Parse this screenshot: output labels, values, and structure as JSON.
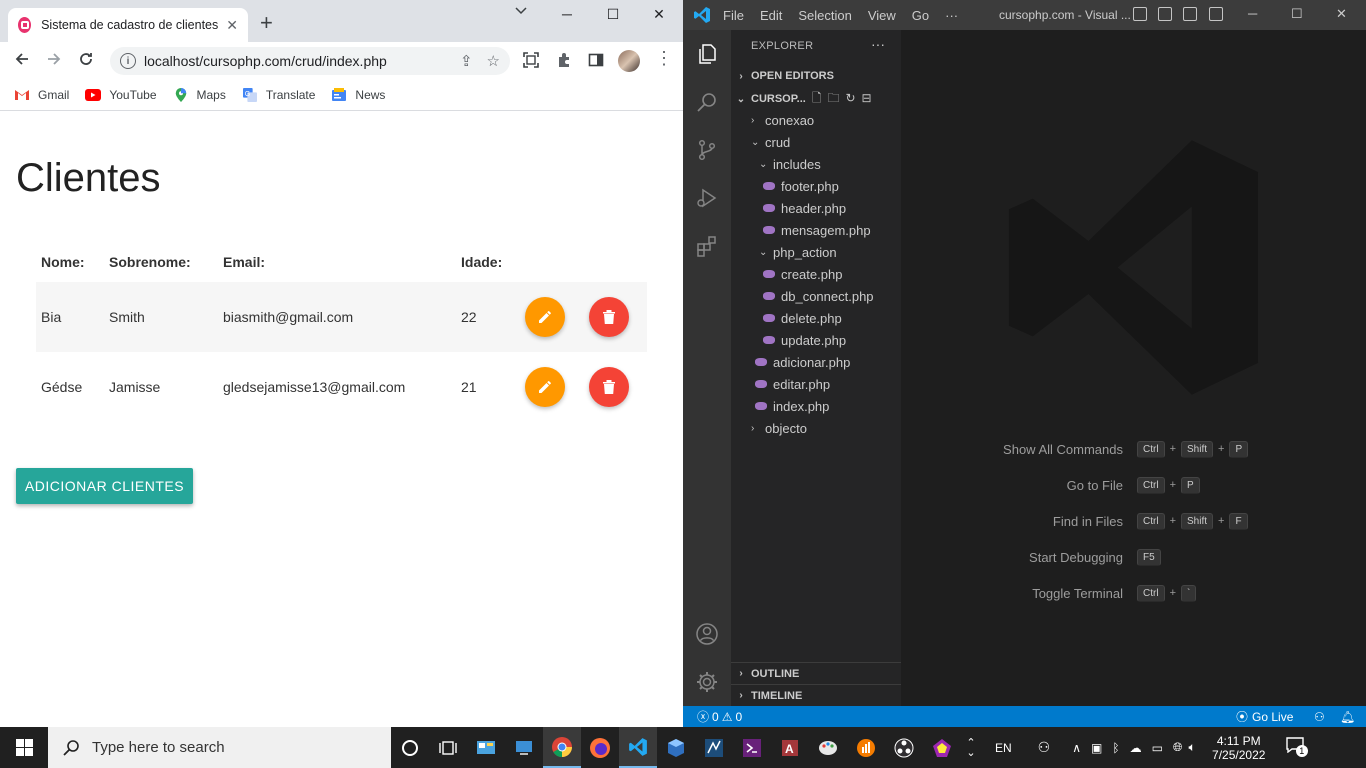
{
  "browser": {
    "tab_title": "Sistema de cadastro de clientes",
    "tab_close": "✕",
    "new_tab": "+",
    "window_controls": {
      "minimize": "─",
      "maximize": "☐",
      "close": "✕"
    },
    "url": "localhost/cursophp.com/crud/index.php",
    "bookmarks": [
      {
        "label": "Gmail",
        "icon": "gmail-icon",
        "color": "#ea4335"
      },
      {
        "label": "YouTube",
        "icon": "youtube-icon",
        "color": "#ff0000"
      },
      {
        "label": "Maps",
        "icon": "maps-icon",
        "color": "#34a853"
      },
      {
        "label": "Translate",
        "icon": "translate-icon",
        "color": "#4285f4"
      },
      {
        "label": "News",
        "icon": "news-icon",
        "color": "#4285f4"
      }
    ]
  },
  "page": {
    "title": "Clientes",
    "table": {
      "headers": [
        "Nome:",
        "Sobrenome:",
        "Email:",
        "Idade:"
      ],
      "rows": [
        {
          "nome": "Bia",
          "sobrenome": "Smith",
          "email": "biasmith@gmail.com",
          "idade": "22"
        },
        {
          "nome": "Gédse",
          "sobrenome": "Jamisse",
          "email": "gledsejamisse13@gmail.com",
          "idade": "21"
        }
      ]
    },
    "add_button": "ADICIONAR CLIENTES",
    "colors": {
      "edit": "#ff9800",
      "delete": "#f44336",
      "add": "#26a69a"
    }
  },
  "vscode": {
    "menu": [
      "File",
      "Edit",
      "Selection",
      "View",
      "Go",
      "···"
    ],
    "window_title": "cursophp.com - Visual ...",
    "explorer_label": "EXPLORER",
    "explorer_more": "···",
    "open_editors": "OPEN EDITORS",
    "folder": "CURSOP...",
    "tree": {
      "conexao": "conexao",
      "crud": "crud",
      "includes": "includes",
      "includes_files": [
        "footer.php",
        "header.php",
        "mensagem.php"
      ],
      "php_action": "php_action",
      "php_action_files": [
        "create.php",
        "db_connect.php",
        "delete.php",
        "update.php"
      ],
      "crud_files": [
        "adicionar.php",
        "editar.php",
        "index.php"
      ],
      "objecto": "objecto"
    },
    "outline": "OUTLINE",
    "timeline": "TIMELINE",
    "shortcuts": [
      {
        "label": "Show All Commands",
        "keys": [
          "Ctrl",
          "Shift",
          "P"
        ]
      },
      {
        "label": "Go to File",
        "keys": [
          "Ctrl",
          "P"
        ]
      },
      {
        "label": "Find in Files",
        "keys": [
          "Ctrl",
          "Shift",
          "F"
        ]
      },
      {
        "label": "Start Debugging",
        "keys": [
          "F5"
        ]
      },
      {
        "label": "Toggle Terminal",
        "keys": [
          "Ctrl",
          "`"
        ]
      }
    ],
    "status": {
      "errors": "0",
      "warnings": "0",
      "go_live": "Go Live"
    }
  },
  "taskbar": {
    "search_placeholder": "Type here to search",
    "language": "EN",
    "time": "4:11 PM",
    "date": "7/25/2022",
    "notification_count": "1"
  }
}
